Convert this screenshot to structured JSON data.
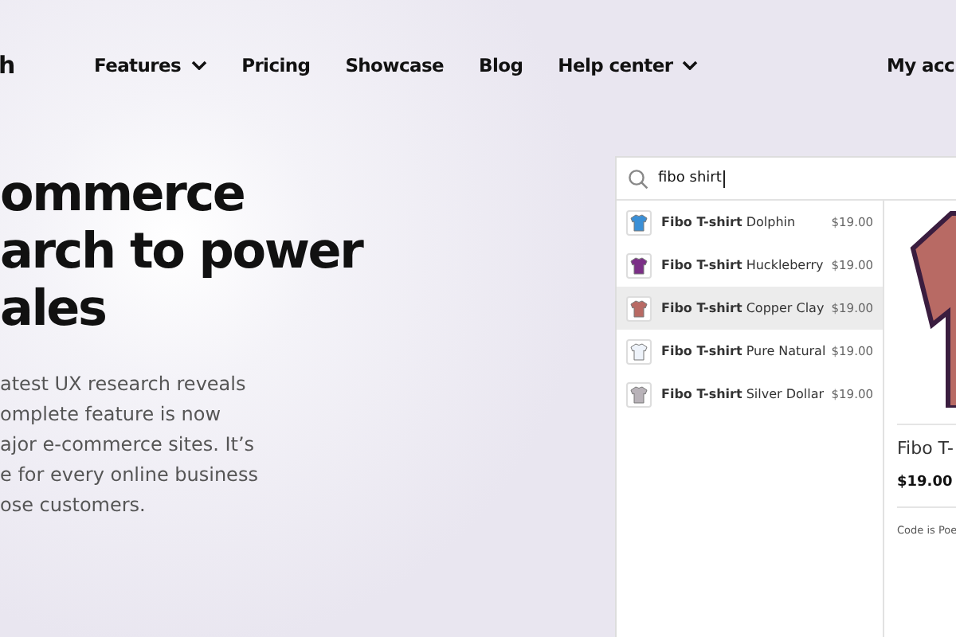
{
  "logo": {
    "text": "h"
  },
  "nav": [
    {
      "label": "Features",
      "dropdown": true
    },
    {
      "label": "Pricing",
      "dropdown": false
    },
    {
      "label": "Showcase",
      "dropdown": false
    },
    {
      "label": "Blog",
      "dropdown": false
    },
    {
      "label": "Help center",
      "dropdown": true
    }
  ],
  "account": {
    "label": "My acc"
  },
  "hero": {
    "title_lines": [
      "ommerce",
      "arch to power",
      "ales"
    ],
    "paragraph_lines": [
      "atest UX research reveals",
      "omplete feature is now",
      "ajor e-commerce sites. It’s",
      "e for every online business",
      "ose customers."
    ]
  },
  "search": {
    "value": "fibo shirt",
    "results": [
      {
        "name": "**Fibo T-shirt** Dolphin",
        "price": "$19.00",
        "color": "#3a8fd6",
        "selected": false
      },
      {
        "name": "**Fibo T-shirt** Huckleberry",
        "price": "$19.00",
        "color": "#7b2f86",
        "selected": false
      },
      {
        "name": "**Fibo T-shirt** Copper Clay",
        "price": "$19.00",
        "color": "#b86a64",
        "selected": true
      },
      {
        "name": "**Fibo T-shirt** Pure Natural",
        "price": "$19.00",
        "color": "#eef3fa",
        "selected": false
      },
      {
        "name": "**Fibo T-shirt** Silver Dollar",
        "price": "$19.00",
        "color": "#b8b2b8",
        "selected": false
      }
    ],
    "detail": {
      "title": "Fibo T-",
      "price": "$19.00",
      "description": "Code is Poe"
    }
  }
}
